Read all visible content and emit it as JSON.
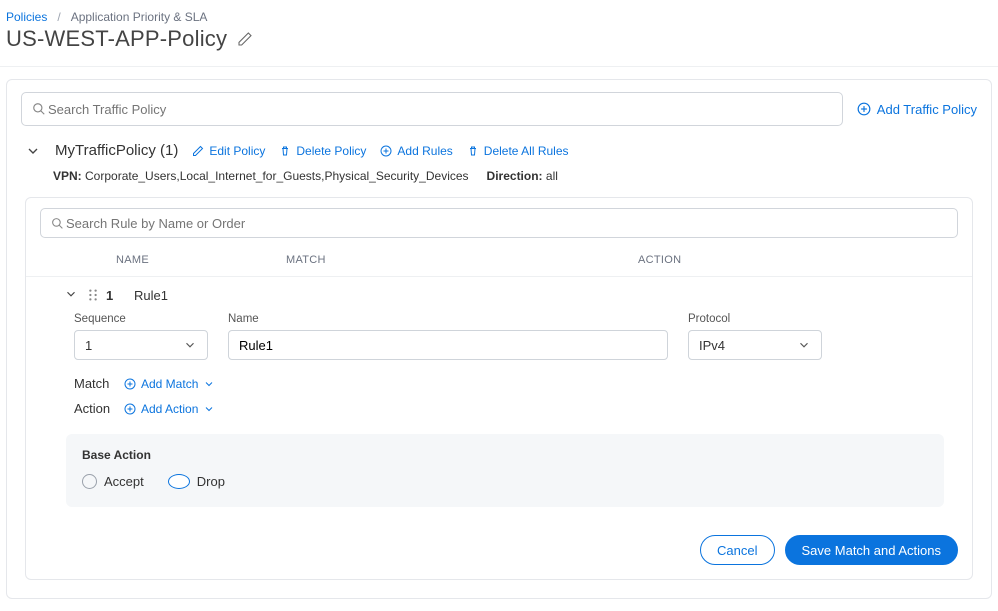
{
  "breadcrumb": {
    "root": "Policies",
    "current": "Application Priority & SLA"
  },
  "page": {
    "title": "US-WEST-APP-Policy"
  },
  "toolbar": {
    "search_placeholder": "Search Traffic Policy",
    "add_traffic_policy": "Add Traffic Policy"
  },
  "section": {
    "title": "MyTrafficPolicy (1)",
    "edit": "Edit Policy",
    "delete": "Delete Policy",
    "add_rules": "Add Rules",
    "delete_all": "Delete All Rules",
    "vpn_label": "VPN:",
    "vpn_value": "Corporate_Users,Local_Internet_for_Guests,Physical_Security_Devices",
    "direction_label": "Direction:",
    "direction_value": "all"
  },
  "rules": {
    "search_placeholder": "Search Rule by Name or Order",
    "columns": {
      "name": "NAME",
      "match": "MATCH",
      "action": "ACTION"
    },
    "item": {
      "order": "1",
      "name": "Rule1"
    },
    "fields": {
      "sequence_label": "Sequence",
      "sequence_value": "1",
      "name_label": "Name",
      "name_value": "Rule1",
      "protocol_label": "Protocol",
      "protocol_value": "IPv4"
    },
    "match": {
      "label": "Match",
      "add": "Add Match"
    },
    "action": {
      "label": "Action",
      "add": "Add Action"
    },
    "base": {
      "title": "Base Action",
      "accept": "Accept",
      "drop": "Drop",
      "selected": "drop"
    },
    "buttons": {
      "cancel": "Cancel",
      "save": "Save Match and Actions"
    }
  }
}
